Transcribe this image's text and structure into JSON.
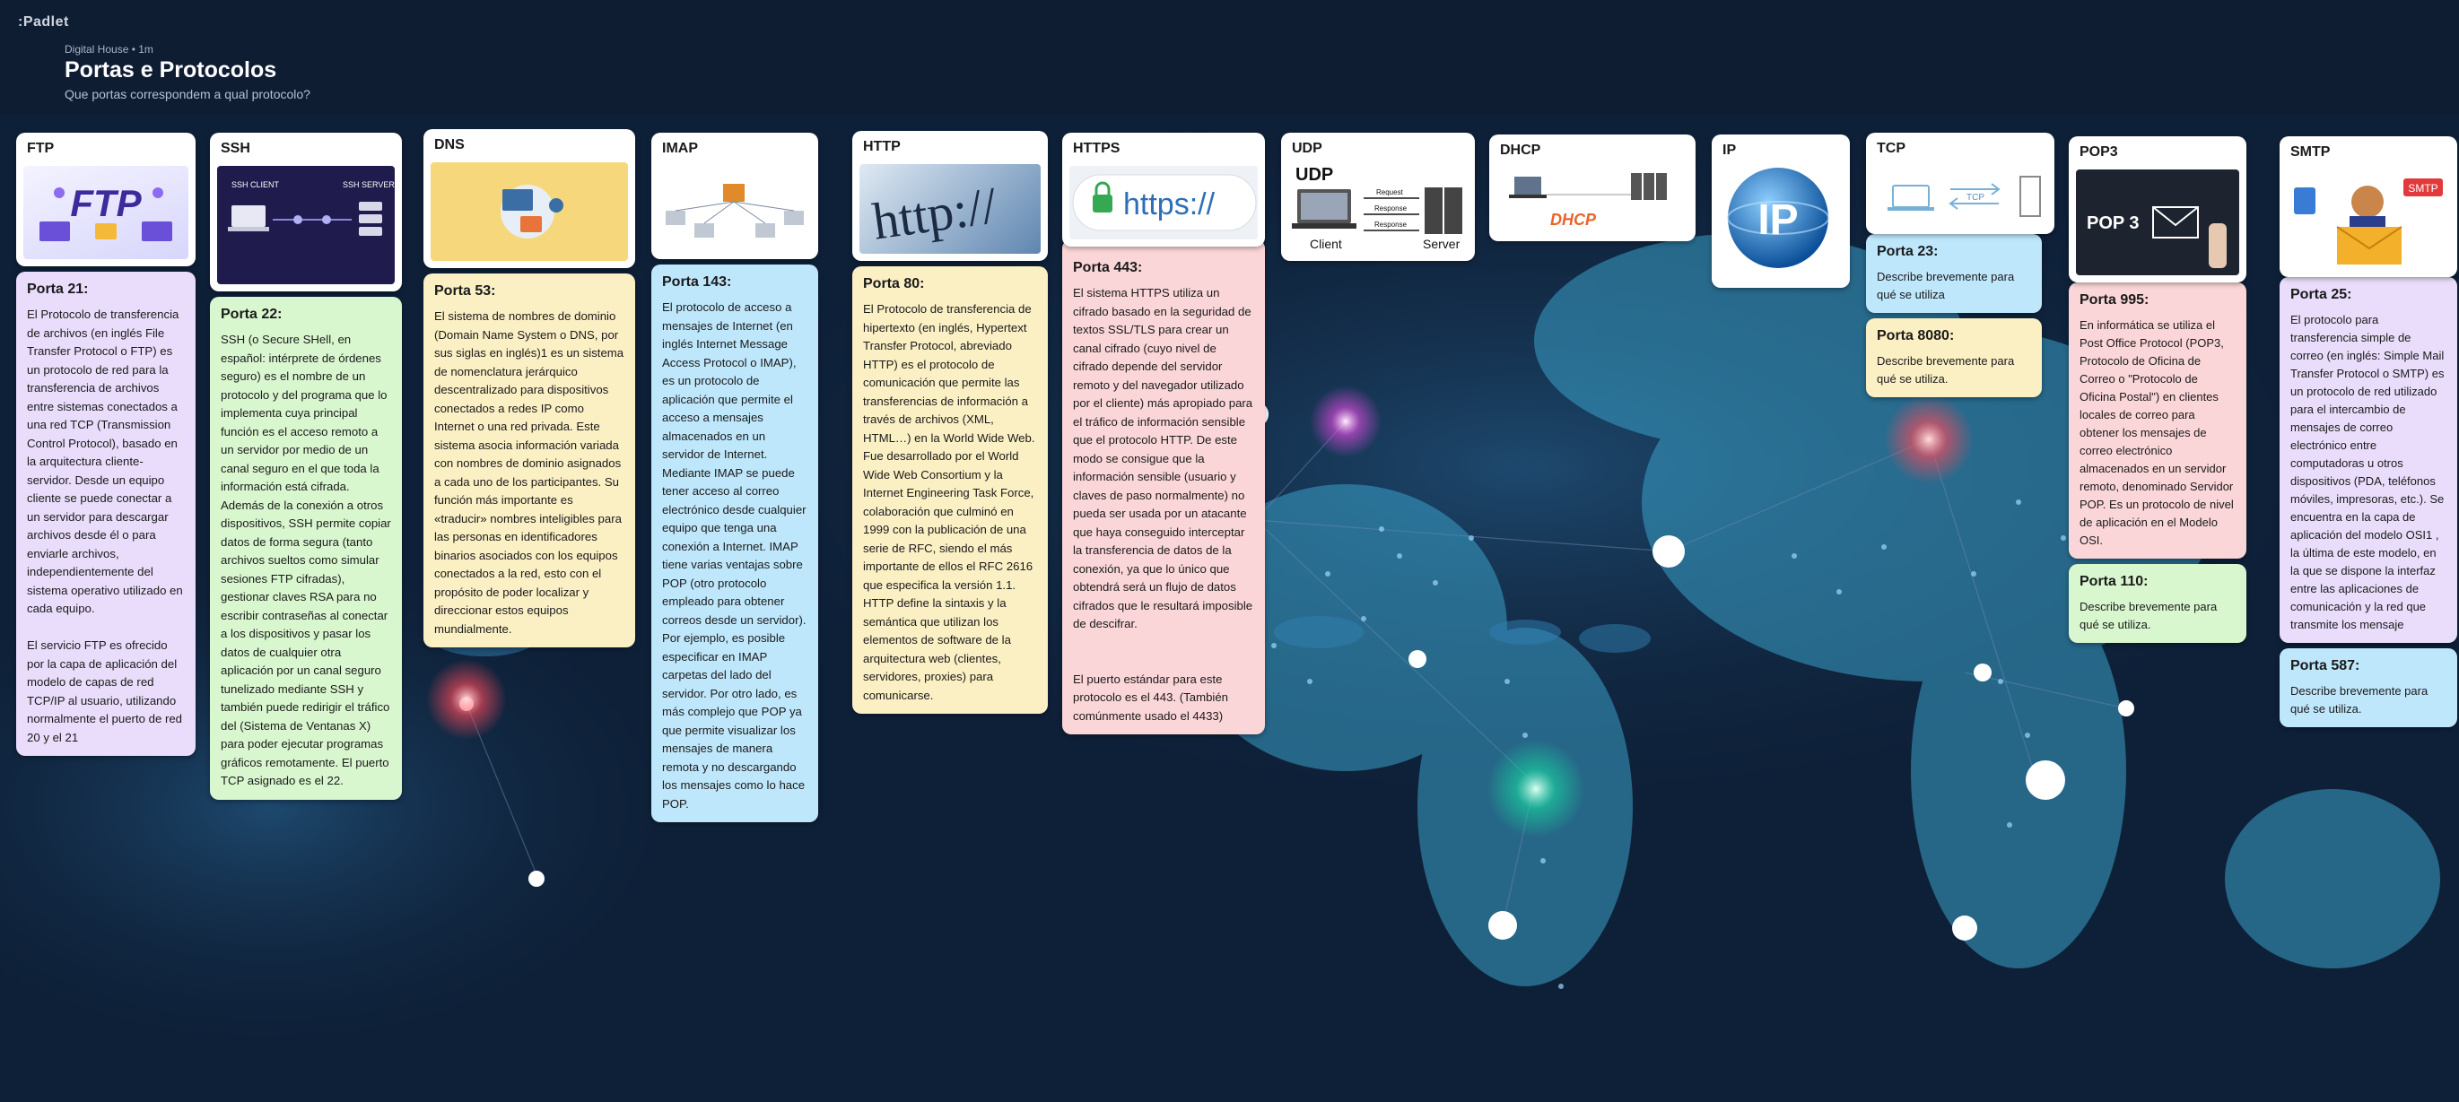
{
  "app": {
    "logo": ":Padlet",
    "meta": "Digital House • 1m",
    "title": "Portas e Protocolos",
    "subtitle": "Que portas correspondem a qual protocolo?"
  },
  "colors": {
    "background": "#0d1c33",
    "purple": "#e9ddfb",
    "green": "#d9f7cf",
    "yellow": "#fbefc4",
    "blue": "#bfe7fb",
    "pink": "#fbd6d8"
  },
  "columns": [
    {
      "title": "FTP",
      "image_icon": "ftp-illustration",
      "cards": [
        {
          "port": "Porta 21:",
          "text": "El Protocolo de transferencia de archivos (en inglés File Transfer Protocol o FTP) es un protocolo de red para la transferencia de archivos entre sistemas conectados a una red TCP (Transmission Control Protocol), basado en la arquitectura cliente-servidor. Desde un equipo cliente se puede conectar a un servidor para descargar archivos desde él o para enviarle archivos, independientemente del sistema operativo utilizado en cada equipo.\n\nEl servicio FTP es ofrecido por la capa de aplicación del modelo de capas de red TCP/IP al usuario, utilizando normalmente el puerto de red 20 y el 21"
        }
      ]
    },
    {
      "title": "SSH",
      "image_icon": "ssh-diagram",
      "cards": [
        {
          "port": "Porta 22:",
          "text": "SSH (o Secure SHell, en español: intérprete de órdenes seguro) es el nombre de un protocolo y del programa que lo implementa cuya principal función es el acceso remoto a un servidor por medio de un canal seguro en el que toda la información está cifrada. Además de la conexión a otros dispositivos, SSH permite copiar datos de forma segura (tanto archivos sueltos como simular sesiones FTP cifradas), gestionar claves RSA para no escribir contraseñas al conectar a los dispositivos y pasar los datos de cualquier otra aplicación por un canal seguro tunelizado mediante SSH y también puede redirigir el tráfico del (Sistema de Ventanas X) para poder ejecutar programas gráficos remotamente. El puerto TCP asignado es el 22."
        }
      ]
    },
    {
      "title": "DNS",
      "image_icon": "dns-illustration",
      "cards": [
        {
          "port": "Porta 53:",
          "text": "El sistema de nombres de dominio (Domain Name System o DNS, por sus siglas en inglés)1 es un sistema de nomenclatura jerárquico descentralizado para dispositivos conectados a redes IP como Internet o una red privada. Este sistema asocia información variada con nombres de dominio asignados a cada uno de los participantes. Su función más importante es «traducir» nombres inteligibles para las personas en identificadores binarios asociados con los equipos conectados a la red, esto con el propósito de poder localizar y direccionar estos equipos mundialmente."
        }
      ]
    },
    {
      "title": "IMAP",
      "image_icon": "imap-network-diagram",
      "cards": [
        {
          "port": "Porta 143:",
          "text": "El protocolo de acceso a mensajes de Internet (en inglés Internet Message Access Protocol o IMAP), es un protocolo de aplicación que permite el acceso a mensajes almacenados en un servidor de Internet. Mediante IMAP se puede tener acceso al correo electrónico desde cualquier equipo que tenga una conexión a Internet. IMAP tiene varias ventajas sobre POP (otro protocolo empleado para obtener correos desde un servidor). Por ejemplo, es posible especificar en IMAP carpetas del lado del servidor. Por otro lado, es más complejo que POP ya que permite visualizar los mensajes de manera remota y no descargando los mensajes como lo hace POP."
        }
      ]
    },
    {
      "title": "HTTP",
      "image_icon": "http-address-bar",
      "cards": [
        {
          "port": "Porta 80:",
          "text": "El Protocolo de transferencia de hipertexto (en inglés, Hypertext Transfer Protocol, abreviado HTTP) es el protocolo de comunicación que permite las transferencias de información a través de archivos (XML, HTML…) en la World Wide Web. Fue desarrollado por el World Wide Web Consortium y la Internet Engineering Task Force, colaboración que culminó en 1999 con la publicación de una serie de RFC, siendo el más importante de ellos el RFC 2616 que especifica la versión 1.1. HTTP define la sintaxis y la semántica que utilizan los elementos de software de la arquitectura web (clientes, servidores, proxies) para comunicarse."
        }
      ]
    },
    {
      "title": "HTTPS",
      "image_icon": "https-lock-bar",
      "image_text": "https://",
      "cards": [
        {
          "port": "Porta 443:",
          "text": "El sistema HTTPS utiliza un cifrado basado en la seguridad de textos SSL/TLS para crear un canal cifrado (cuyo nivel de cifrado depende del servidor remoto y del navegador utilizado por el cliente) más apropiado para el tráfico de información sensible que el protocolo HTTP. De este modo se consigue que la información sensible (usuario y claves de paso normalmente) no pueda ser usada por un atacante que haya conseguido interceptar la transferencia de datos de la conexión, ya que lo único que obtendrá será un flujo de datos cifrados que le resultará imposible de descifrar.\n\n\nEl puerto estándar para este protocolo es el 443. (También comúnmente usado el 4433)"
        }
      ]
    },
    {
      "title": "UDP",
      "image_icon": "udp-client-server",
      "image_labels": {
        "udp": "UDP",
        "client": "Client",
        "server": "Server",
        "request": "Request",
        "response1": "Response",
        "response2": "Response"
      },
      "cards": []
    },
    {
      "title": "DHCP",
      "image_icon": "dhcp-diagram",
      "image_text": "DHCP",
      "cards": []
    },
    {
      "title": "IP",
      "image_icon": "ip-globe",
      "image_text": "IP",
      "cards": []
    },
    {
      "title": "TCP",
      "image_icon": "tcp-diagram",
      "image_text": "TCP",
      "cards": [
        {
          "port": "Porta 23:",
          "text": "Describe brevemente para qué se utiliza"
        },
        {
          "port": "Porta 8080:",
          "text": "Describe brevemente para qué se utiliza."
        }
      ]
    },
    {
      "title": "POP3",
      "image_icon": "pop3-envelope",
      "image_text": "POP 3",
      "cards": [
        {
          "port": "Porta 995:",
          "text": "En informática se utiliza el Post Office Protocol (POP3, Protocolo de Oficina de Correo o \"Protocolo de Oficina Postal\") en clientes locales de correo para obtener los mensajes de correo electrónico almacenados en un servidor remoto, denominado Servidor POP. Es un protocolo de nivel de aplicación en el Modelo OSI."
        },
        {
          "port": "Porta 110:",
          "text": "Describe brevemente para qué se utiliza."
        }
      ]
    },
    {
      "title": "SMTP",
      "image_icon": "smtp-mail-illustration",
      "image_text": "SMTP",
      "cards": [
        {
          "port": "Porta 25:",
          "text": "El protocolo para transferencia simple de correo (en inglés: Simple Mail Transfer Protocol o SMTP) es un protocolo de red utilizado para el intercambio de mensajes de correo electrónico entre computadoras u otros dispositivos (PDA, teléfonos móviles, impresoras, etc.). Se encuentra en la capa de aplicación del modelo OSI1 , la última de este modelo, en la que se dispone la interfaz entre las aplicaciones de comunicación y la red que transmite los mensaje"
        },
        {
          "port": "Porta 587:",
          "text": "Describe brevemente para qué se utiliza."
        }
      ]
    }
  ]
}
